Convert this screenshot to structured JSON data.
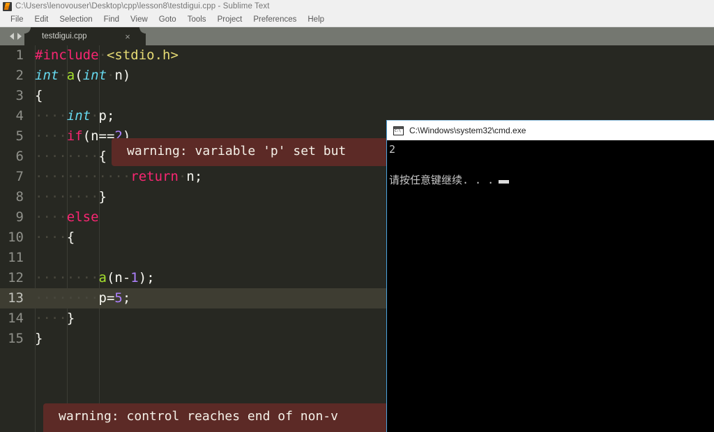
{
  "sublime": {
    "titlebar": {
      "icon": "sublime-text-icon",
      "title": "C:\\Users\\lenovouser\\Desktop\\cpp\\lesson8\\testdigui.cpp - Sublime Text"
    },
    "menubar": [
      {
        "label": "File"
      },
      {
        "label": "Edit"
      },
      {
        "label": "Selection"
      },
      {
        "label": "Find"
      },
      {
        "label": "View"
      },
      {
        "label": "Goto"
      },
      {
        "label": "Tools"
      },
      {
        "label": "Project"
      },
      {
        "label": "Preferences"
      },
      {
        "label": "Help"
      }
    ],
    "tabbar": {
      "prev_icon": "chevron-left-icon",
      "next_icon": "chevron-right-icon",
      "tab_label": "testdigui.cpp",
      "close_label": "×"
    },
    "editor": {
      "active_line": 13,
      "lines": [
        {
          "n": "1",
          "tokens": [
            {
              "t": "#include",
              "c": "kw"
            },
            {
              "t": "·",
              "c": "dot"
            },
            {
              "t": "<stdio.h>",
              "c": "str"
            }
          ]
        },
        {
          "n": "2",
          "tokens": [
            {
              "t": "int",
              "c": "type"
            },
            {
              "t": "·",
              "c": "dot"
            },
            {
              "t": "a",
              "c": "fn"
            },
            {
              "t": "(",
              "c": "pl"
            },
            {
              "t": "int",
              "c": "type"
            },
            {
              "t": "·",
              "c": "dot"
            },
            {
              "t": "n)",
              "c": "pl"
            }
          ]
        },
        {
          "n": "3",
          "tokens": [
            {
              "t": "{",
              "c": "pl"
            }
          ]
        },
        {
          "n": "4",
          "tokens": [
            {
              "t": "····",
              "c": "dot"
            },
            {
              "t": "int",
              "c": "type"
            },
            {
              "t": "·",
              "c": "dot"
            },
            {
              "t": "p;",
              "c": "pl"
            }
          ]
        },
        {
          "n": "5",
          "tokens": [
            {
              "t": "····",
              "c": "dot"
            },
            {
              "t": "if",
              "c": "kw"
            },
            {
              "t": "(n==",
              "c": "pl"
            },
            {
              "t": "2",
              "c": "num"
            },
            {
              "t": ")",
              "c": "pl"
            }
          ]
        },
        {
          "n": "6",
          "tokens": [
            {
              "t": "········",
              "c": "dot"
            },
            {
              "t": "{",
              "c": "pl"
            }
          ]
        },
        {
          "n": "7",
          "tokens": [
            {
              "t": "············",
              "c": "dot"
            },
            {
              "t": "return",
              "c": "kw"
            },
            {
              "t": "·",
              "c": "dot"
            },
            {
              "t": "n;",
              "c": "pl"
            }
          ]
        },
        {
          "n": "8",
          "tokens": [
            {
              "t": "········",
              "c": "dot"
            },
            {
              "t": "}",
              "c": "pl"
            }
          ]
        },
        {
          "n": "9",
          "tokens": [
            {
              "t": "····",
              "c": "dot"
            },
            {
              "t": "else",
              "c": "kw"
            }
          ]
        },
        {
          "n": "10",
          "tokens": [
            {
              "t": "····",
              "c": "dot"
            },
            {
              "t": "{",
              "c": "pl"
            }
          ]
        },
        {
          "n": "11",
          "tokens": []
        },
        {
          "n": "12",
          "tokens": [
            {
              "t": "········",
              "c": "dot"
            },
            {
              "t": "a",
              "c": "fn"
            },
            {
              "t": "(n-",
              "c": "pl"
            },
            {
              "t": "1",
              "c": "num"
            },
            {
              "t": ");",
              "c": "pl"
            }
          ]
        },
        {
          "n": "13",
          "tokens": [
            {
              "t": "········",
              "c": "dot"
            },
            {
              "t": "p=",
              "c": "pl"
            },
            {
              "t": "5",
              "c": "num"
            },
            {
              "t": ";",
              "c": "pl"
            }
          ]
        },
        {
          "n": "14",
          "tokens": [
            {
              "t": "····",
              "c": "dot"
            },
            {
              "t": "}",
              "c": "pl"
            }
          ]
        },
        {
          "n": "15",
          "tokens": [
            {
              "t": "}",
              "c": "pl"
            }
          ]
        }
      ]
    },
    "warnings": {
      "top": "warning: variable 'p' set but",
      "bottom": "warning: control reaches end of non-v"
    }
  },
  "cmd": {
    "icon": "cmd-exe-icon",
    "title": "C:\\Windows\\system32\\cmd.exe",
    "output": [
      "2",
      "",
      "请按任意键继续. . ."
    ]
  },
  "colors": {
    "editor_bg": "#272822",
    "active_line": "#3e3d32",
    "keyword": "#f92672",
    "string": "#e6db74",
    "type": "#66d9ef",
    "function": "#a6e22e",
    "number": "#ae81ff",
    "warning_bg": "#5c2a26",
    "titlebar_bg": "#f0f0f0",
    "tabbar_bg": "#747770",
    "cmd_bg": "#000000",
    "cmd_border": "#4aa3df"
  }
}
